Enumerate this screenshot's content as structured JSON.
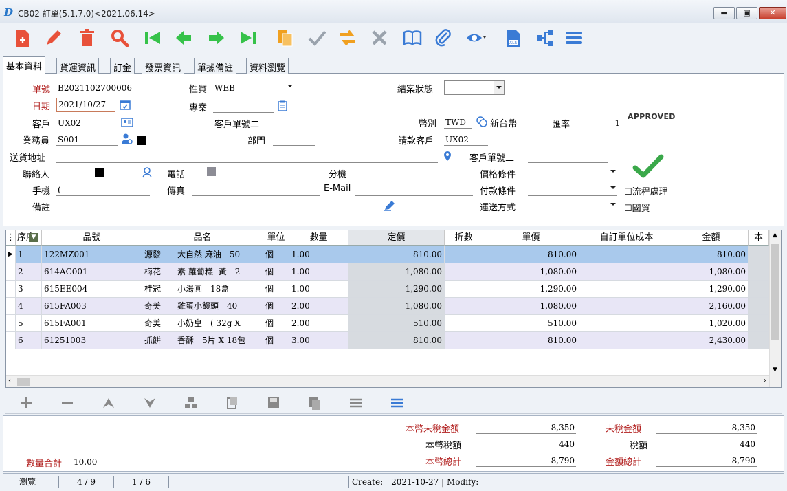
{
  "window": {
    "title": "CB02 訂單(5.1.7.0)<2021.06.14>",
    "logo": "D",
    "min": "▬",
    "max": "▣",
    "close": "✕"
  },
  "toolbar": [
    {
      "name": "new-doc-icon",
      "color": "#e8513a"
    },
    {
      "name": "edit-pencil-icon",
      "color": "#e8513a"
    },
    {
      "name": "delete-trash-icon",
      "color": "#e8513a"
    },
    {
      "name": "search-icon",
      "color": "#e8513a"
    },
    {
      "name": "first-record-icon",
      "color": "#36c24a"
    },
    {
      "name": "prev-record-icon",
      "color": "#36c24a"
    },
    {
      "name": "next-record-icon",
      "color": "#36c24a"
    },
    {
      "name": "last-record-icon",
      "color": "#36c24a"
    },
    {
      "name": "copy-doc-icon",
      "color": "#f0a020"
    },
    {
      "name": "confirm-check-icon",
      "color": "#9aa3ad"
    },
    {
      "name": "transfer-icon",
      "color": "#f0a020"
    },
    {
      "name": "cancel-x-icon",
      "color": "#9aa3ad"
    },
    {
      "name": "book-icon",
      "color": "#3a7bd5"
    },
    {
      "name": "attachment-clip-icon",
      "color": "#3a7bd5"
    },
    {
      "name": "view-eye-icon",
      "color": "#3a7bd5"
    },
    {
      "name": "export-xls-icon",
      "color": "#3a7bd5"
    },
    {
      "name": "flow-tree-icon",
      "color": "#3a7bd5"
    },
    {
      "name": "menu-lines-icon",
      "color": "#3a7bd5"
    }
  ],
  "tabs": [
    "基本資料",
    "貨運資訊",
    "訂金",
    "發票資訊",
    "單據備註",
    "資料瀏覽"
  ],
  "form": {
    "order_no_label": "單號",
    "order_no": "B2021102700006",
    "nature_label": "性質",
    "nature": "WEB",
    "close_status_label": "結案狀態",
    "close_status": "",
    "date_label": "日期",
    "date": "2021/10/27",
    "project_label": "專案",
    "project": "",
    "customer_label": "客戶",
    "customer": "UX02",
    "cust_order_label": "客戶單號二",
    "cust_order": "",
    "currency_label": "幣別",
    "currency": "TWD",
    "currency_name": "新台幣",
    "rate_label": "匯率",
    "rate": "1",
    "sales_label": "業務員",
    "sales": "S001",
    "dept_label": "部門",
    "dept": "",
    "bill_cust_label": "請款客戶",
    "bill_cust": "UX02",
    "ship_addr_label": "送貨地址",
    "ship_addr": "",
    "cust_order2_label": "客戶單號二",
    "cust_order2": "",
    "contact_label": "聯絡人",
    "contact": "",
    "phone_label": "電話",
    "phone": "",
    "ext_label": "分機",
    "ext": "",
    "price_terms_label": "價格條件",
    "price_terms": "",
    "mobile_label": "手機",
    "mobile": "(",
    "fax_label": "傳真",
    "fax": "",
    "email_label": "E-Mail",
    "email": "",
    "pay_terms_label": "付款條件",
    "pay_terms": "",
    "workflow_label": "☐流程處理",
    "remark_label": "備註",
    "remark": "",
    "ship_method_label": "運送方式",
    "ship_method": "",
    "trade_label": "☐國貿",
    "approved": "APPROVED"
  },
  "grid": {
    "headers": [
      "序",
      "品號",
      "品名",
      "單位",
      "數量",
      "定價",
      "折數",
      "單價",
      "自訂單位成本",
      "金額",
      "本"
    ],
    "rows": [
      [
        "1",
        "122MZ001",
        "源發",
        "大自然 麻油　50",
        "個",
        "1.00",
        "810.00",
        "",
        "810.00",
        "",
        "810.00"
      ],
      [
        "2",
        "614AC001",
        "梅花",
        "素 蘿蔔糕- 黃　2",
        "個",
        "1.00",
        "1,080.00",
        "",
        "1,080.00",
        "",
        "1,080.00"
      ],
      [
        "3",
        "615EE004",
        "桂冠",
        "小湯圓　18盒",
        "個",
        "1.00",
        "1,290.00",
        "",
        "1,290.00",
        "",
        "1,290.00"
      ],
      [
        "4",
        "615FA003",
        "奇美",
        "雞蛋小饅頭　40",
        "個",
        "2.00",
        "1,080.00",
        "",
        "1,080.00",
        "",
        "2,160.00"
      ],
      [
        "5",
        "615FA001",
        "奇美",
        "小奶皇　( 32g X",
        "個",
        "2.00",
        "510.00",
        "",
        "510.00",
        "",
        "1,020.00"
      ],
      [
        "6",
        "61251003",
        "抓餅",
        "香酥　5片 X 18包",
        "個",
        "3.00",
        "810.00",
        "",
        "810.00",
        "",
        "2,430.00"
      ]
    ]
  },
  "gridbar": [
    "add-row-icon",
    "remove-row-icon",
    "move-up-icon",
    "move-down-icon",
    "group-icon",
    "paste-icon",
    "save-icon",
    "copy-icon",
    "list-icon",
    "list-active-icon"
  ],
  "summary": {
    "local_untaxed_label": "本幣未稅金額",
    "local_untaxed": "8,350",
    "local_tax_label": "本幣稅額",
    "local_tax": "440",
    "local_total_label": "本幣總計",
    "local_total": "8,790",
    "untaxed_label": "未稅金額",
    "untaxed": "8,350",
    "tax_label": "稅額",
    "tax": "440",
    "total_label": "金額總計",
    "total": "8,790",
    "qty_total_label": "數量合計",
    "qty_total": "10.00"
  },
  "status": {
    "mode": "瀏覽",
    "record": "4 / 9",
    "page": "1 / 6",
    "create": "Create:　2021-10-27 | Modify:"
  },
  "colors": {
    "selected_row": "#a9c9ec",
    "alt_row": "#e8e6f6",
    "price_col": "#d7dbe0",
    "required_label": "#b2201f",
    "approved_green": "#3aa84a"
  }
}
